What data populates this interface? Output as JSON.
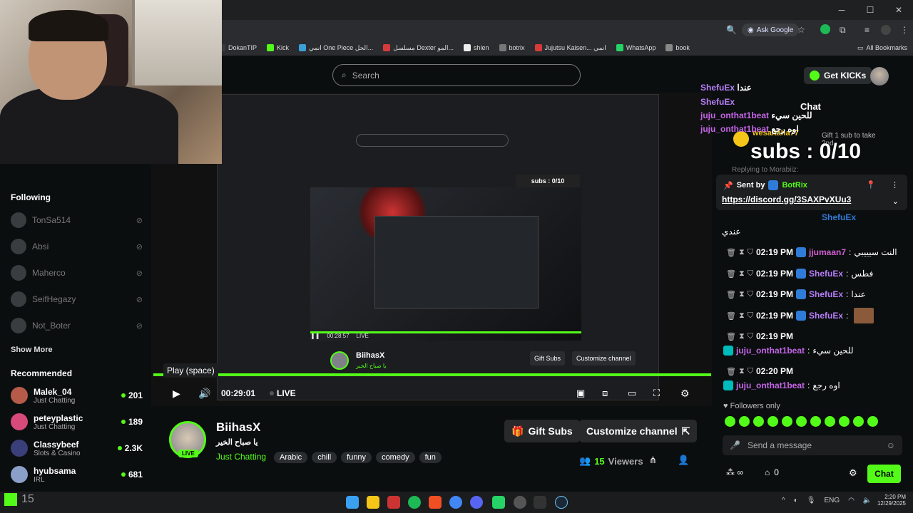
{
  "browser": {
    "ask_google": "Ask Google",
    "bookmarks": [
      {
        "label": "DokanTIP",
        "color": "#3a3a3a"
      },
      {
        "label": "Kick",
        "color": "#53fc18"
      },
      {
        "label": "انمي One Piece الحل...",
        "color": "#3aa1d8"
      },
      {
        "label": "مسلسل Dexter المو...",
        "color": "#d83a3a"
      },
      {
        "label": "shien",
        "color": "#eeeeee"
      },
      {
        "label": "botrix",
        "color": "#777777"
      },
      {
        "label": "Jujutsu Kaisen... انمي",
        "color": "#d83a3a"
      },
      {
        "label": "WhatsApp",
        "color": "#25d366"
      },
      {
        "label": "book",
        "color": "#888888"
      }
    ],
    "all_bookmarks": "All Bookmarks"
  },
  "header": {
    "search_placeholder": "Search",
    "get_kicks": "Get KICKs"
  },
  "sidebar": {
    "following_title": "Following",
    "following": [
      {
        "name": "TonSa514"
      },
      {
        "name": "Absi"
      },
      {
        "name": "Maherco"
      },
      {
        "name": "SeifHegazy"
      },
      {
        "name": "Not_Boter"
      }
    ],
    "show_more": "Show More",
    "recommended_title": "Recommended",
    "recommended": [
      {
        "name": "Malek_04",
        "category": "Just Chatting",
        "viewers": "201",
        "color": "#b65a4a"
      },
      {
        "name": "peteyplastic",
        "category": "Just Chatting",
        "viewers": "189",
        "color": "#d84a7a"
      },
      {
        "name": "Classybeef",
        "category": "Slots & Casino",
        "viewers": "2.3K",
        "color": "#3a3f7a"
      },
      {
        "name": "hyubsama",
        "category": "IRL",
        "viewers": "681",
        "color": "#8aa0c8"
      }
    ]
  },
  "player": {
    "tooltip": "Play (space)",
    "time": "00:29:01",
    "live": "LIVE",
    "nested_time": "00:28:57",
    "nested_streamer": "BiihasX",
    "nested_title": "يا صباح الخير",
    "nested_gift": "Gift Subs",
    "nested_customize": "Customize channel"
  },
  "stream": {
    "streamer": "BiihasX",
    "title": "يا صباح الخير",
    "category": "Just Chatting",
    "live_badge": "LIVE",
    "tags": [
      "Arabic",
      "chill",
      "funny",
      "comedy",
      "fun"
    ],
    "gift_subs": "Gift Subs",
    "customize": "Customize channel",
    "viewers_count": "15",
    "viewers_label": "Viewers"
  },
  "chat": {
    "title": "Chat",
    "gift_sub": "Gift 1 sub to take",
    "gift_sub_2": "2nd",
    "gift_user": "wesaltaha77",
    "replying": "Replying to Morabiiz:",
    "pinned_by": "Sent by",
    "pinned_sender": "BotRix",
    "pinned_link": "https://discord.gg/3SAXPvXUu3",
    "partial_user": "ShefuEx",
    "partial_text": "عندي",
    "messages": [
      {
        "time": "02:19 PM",
        "user": "jjumaan7",
        "text": "النت سيييبي",
        "color": "#d35fd3"
      },
      {
        "time": "02:19 PM",
        "user": "ShefuEx",
        "text": "فطس",
        "color": "#b67ef7"
      },
      {
        "time": "02:19 PM",
        "user": "ShefuEx",
        "text": "عندا",
        "color": "#b67ef7"
      },
      {
        "time": "02:19 PM",
        "user": "ShefuEx",
        "text": "",
        "color": "#b67ef7"
      },
      {
        "time": "02:19 PM",
        "user": "juju_onthat1beat",
        "text": "للحين سيء",
        "color": "#c565e8"
      },
      {
        "time": "02:20 PM",
        "user": "juju_onthat1beat",
        "text": "اوه رجع",
        "color": "#c565e8"
      }
    ],
    "followers_only": "Followers only",
    "send_placeholder": "Send a message",
    "gift_count": "0",
    "chat_button": "Chat"
  },
  "overlay": {
    "subs_goal": "subs : 0/10",
    "lines": [
      {
        "user": "ShefuEx",
        "text": "عندا",
        "color": "#b67ef7"
      },
      {
        "user": "ShefuEx",
        "text": "",
        "color": "#b67ef7"
      },
      {
        "user": "juju_onthat1beat",
        "text": "للحين سيء",
        "color": "#c565e8"
      },
      {
        "user": "juju_onthat1beat",
        "text": "اوه رجع",
        "color": "#c565e8"
      }
    ]
  },
  "taskbar": {
    "left_count": "15",
    "lang": "ENG",
    "clock_time": "2:20 PM",
    "clock_date": "12/29/2025"
  },
  "colors": {
    "accent": "#53fc18",
    "bg": "#0b0e0f"
  }
}
